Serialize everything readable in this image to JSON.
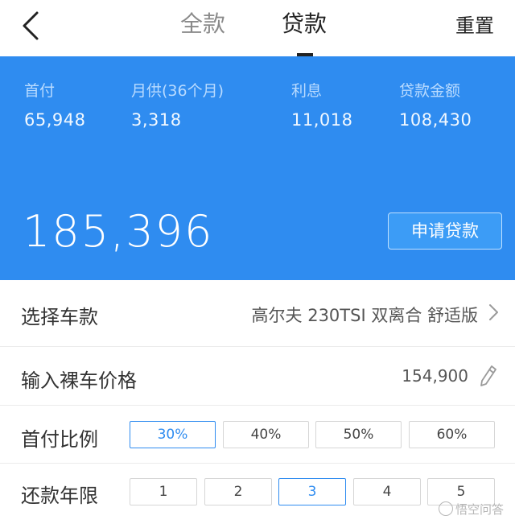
{
  "header": {
    "back_icon": "chevron-left-icon",
    "tabs": [
      {
        "label": "全款",
        "active": false
      },
      {
        "label": "贷款",
        "active": true
      }
    ],
    "reset_label": "重置"
  },
  "summary": {
    "stats": [
      {
        "label": "首付",
        "value": "65,948"
      },
      {
        "label": "月供(36个月)",
        "value": "3,318"
      },
      {
        "label": "利息",
        "value": "11,018"
      },
      {
        "label": "贷款金额",
        "value": "108,430"
      }
    ],
    "total": "185,396",
    "apply_label": "申请贷款",
    "background_color": "#2f8cf0"
  },
  "form": {
    "car_model": {
      "label": "选择车款",
      "value": "高尔夫 230TSI 双离合 舒适版"
    },
    "bare_price": {
      "label": "输入裸车价格",
      "value": "154,900"
    },
    "down_payment_ratio": {
      "label": "首付比例",
      "options": [
        "30%",
        "40%",
        "50%",
        "60%"
      ],
      "selected": "30%"
    },
    "loan_term": {
      "label": "还款年限",
      "options": [
        "1",
        "2",
        "3",
        "4",
        "5"
      ],
      "selected": "3"
    }
  },
  "watermark": {
    "text": "悟空问答"
  }
}
